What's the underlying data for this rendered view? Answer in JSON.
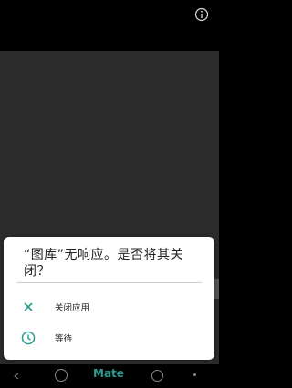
{
  "dialog": {
    "title": "“图库”无响应。是否将其关闭？",
    "options": [
      {
        "label": "关闭应用",
        "icon": "close-icon"
      },
      {
        "label": "等待",
        "icon": "clock-icon"
      }
    ]
  },
  "nav": {
    "logo": "Mate"
  },
  "colors": {
    "accent": "#2a9a8e",
    "background": "#2b2b2b",
    "dialog_bg": "#ffffff"
  }
}
